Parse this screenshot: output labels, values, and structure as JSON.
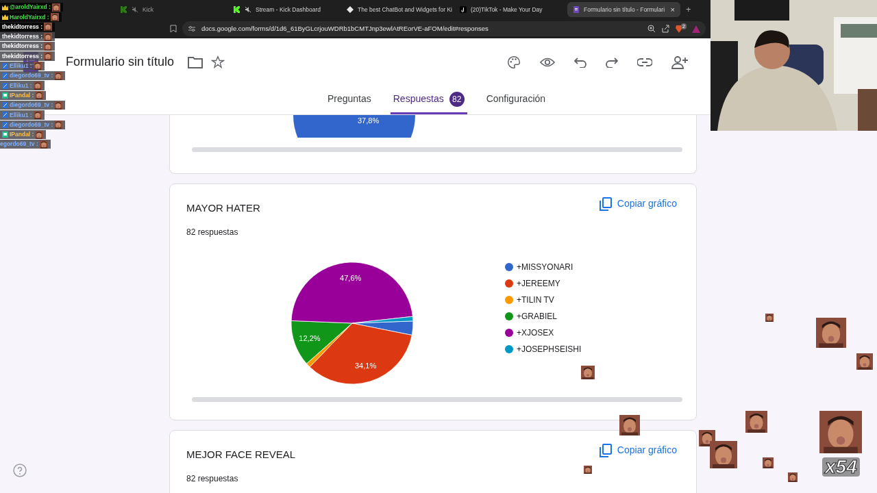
{
  "browser": {
    "tabs": [
      {
        "title": "Kick",
        "kind": "kick",
        "muted": true,
        "selected": false,
        "faded": true
      },
      {
        "title": "Stream - Kick Dashboard",
        "kind": "kick",
        "muted": true,
        "selected": false,
        "faded": false
      },
      {
        "title": "The best ChatBot and Widgets for Ki",
        "kind": "diamond",
        "muted": false,
        "selected": false,
        "faded": false
      },
      {
        "title": "(20)TikTok - Make Your Day",
        "kind": "tiktok",
        "muted": false,
        "selected": false,
        "faded": false
      },
      {
        "title": "Formulario sin título - Formulari",
        "kind": "forms",
        "muted": false,
        "selected": true,
        "faded": false,
        "close": "×"
      }
    ],
    "new_tab": "+",
    "url": "docs.google.com/forms/d/1d6_61ByGLcrjouWDRb1bCMTJnp3ewlAtREorVE-aFOM/edit#responses",
    "shield_badge": "2"
  },
  "form": {
    "title": "Formulario sin título",
    "tabs": [
      {
        "label": "Preguntas",
        "selected": false
      },
      {
        "label": "Respuestas",
        "selected": true,
        "count": "82"
      },
      {
        "label": "Configuración",
        "selected": false
      }
    ]
  },
  "top_card": {
    "slice_label": "37,8%"
  },
  "cards": [
    {
      "title": "MAYOR HATER",
      "count": "82 respuestas",
      "action": "Copiar gráfico",
      "chart_data": {
        "type": "pie",
        "categories": [
          "+MISSYONARI",
          "+JEREEMY",
          "+TILIN TV",
          "+GRABIEL",
          "+XJOSEX",
          "+JOSEPHSEISHI"
        ],
        "values": [
          3.7,
          34.1,
          1.2,
          12.2,
          47.6,
          1.2
        ],
        "colors": [
          "#3366cc",
          "#dc3912",
          "#ff9900",
          "#109618",
          "#990099",
          "#0099c6"
        ],
        "value_labels": [
          null,
          "34,1%",
          null,
          "12,2%",
          "47,6%",
          null
        ]
      }
    },
    {
      "title": "MEJOR FACE REVEAL",
      "count": "82 respuestas",
      "action": "Copiar gráfico"
    }
  ],
  "chat": [
    {
      "user": "@aroldYairxd :",
      "kind": "crown"
    },
    {
      "user": "HaroldYairxd :",
      "kind": "crown"
    },
    {
      "user": "thekidtorress :",
      "kind": "plain"
    },
    {
      "user": "thekidtorress :",
      "kind": "plain"
    },
    {
      "user": "thekidtorress :",
      "kind": "plain"
    },
    {
      "user": "thekidtorress :",
      "kind": "plain"
    },
    {
      "user": "Elliku1 :",
      "kind": "blue"
    },
    {
      "user": "diegordo69_tv :",
      "kind": "blue"
    },
    {
      "user": "Elliku1 :",
      "kind": "blue"
    },
    {
      "user": "IPandal :",
      "kind": "green"
    },
    {
      "user": "diegordo69_tv :",
      "kind": "blue"
    },
    {
      "user": "Elliku1 :",
      "kind": "blue"
    },
    {
      "user": "diegordo69_tv :",
      "kind": "blue"
    },
    {
      "user": "IPandal :",
      "kind": "green"
    },
    {
      "user": "egordo69_tv :",
      "kind": "cut"
    }
  ],
  "emote_counter": "x54"
}
